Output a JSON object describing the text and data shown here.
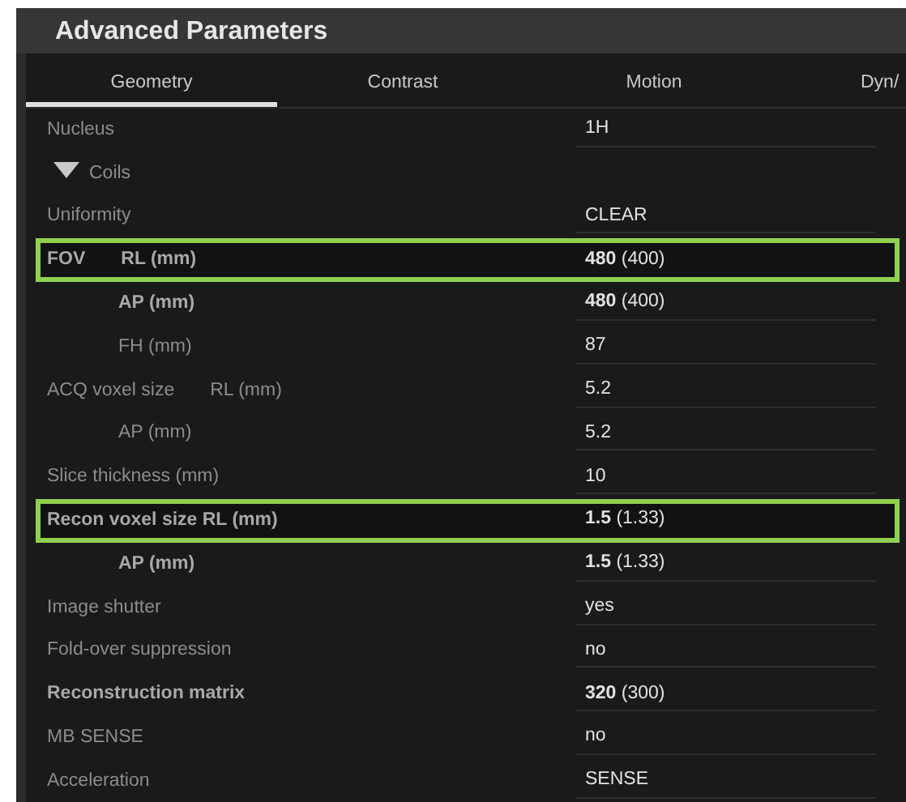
{
  "window": {
    "title": "Advanced Parameters"
  },
  "tabs": [
    {
      "label": "Geometry",
      "selected": true
    },
    {
      "label": "Contrast",
      "selected": false
    },
    {
      "label": "Motion",
      "selected": false
    },
    {
      "label": "Dyn/",
      "selected": false
    }
  ],
  "rows": [
    {
      "kind": "param",
      "label": "Nucleus",
      "value": "1H",
      "modified": false,
      "highlighted": false
    },
    {
      "kind": "group",
      "label": "Coils",
      "expanded": true
    },
    {
      "kind": "param",
      "label": "Uniformity",
      "value": "CLEAR",
      "modified": false,
      "highlighted": false
    },
    {
      "kind": "param",
      "label": "FOV",
      "sublabel": "RL (mm)",
      "value": "**480** (400)",
      "modified": true,
      "highlighted": true
    },
    {
      "kind": "param",
      "sublabel": "AP (mm)",
      "value": "**480** (400)",
      "modified": true,
      "highlighted": false
    },
    {
      "kind": "param",
      "sublabel": "FH (mm)",
      "value": "87",
      "modified": false,
      "highlighted": false
    },
    {
      "kind": "param",
      "label": "ACQ voxel size",
      "sublabel": "RL (mm)",
      "value": "5.2",
      "modified": false,
      "highlighted": false
    },
    {
      "kind": "param",
      "sublabel": "AP (mm)",
      "value": "5.2",
      "modified": false,
      "highlighted": false
    },
    {
      "kind": "param",
      "label": "Slice thickness (mm)",
      "value": "10",
      "modified": false,
      "highlighted": false
    },
    {
      "kind": "param",
      "label": "Recon voxel size RL (mm)",
      "value": "**1.5** (1.33)",
      "modified": true,
      "highlighted": true
    },
    {
      "kind": "param",
      "sublabel": "AP (mm)",
      "value": "**1.5** (1.33)",
      "modified": true,
      "highlighted": false
    },
    {
      "kind": "param",
      "label": "Image shutter",
      "value": "yes",
      "modified": false,
      "highlighted": false
    },
    {
      "kind": "param",
      "label": "Fold-over suppression",
      "value": "no",
      "modified": false,
      "highlighted": false
    },
    {
      "kind": "param",
      "label": "Reconstruction matrix",
      "value": "**320** (300)",
      "modified": true,
      "highlighted": false
    },
    {
      "kind": "param",
      "label": "MB SENSE",
      "value": "no",
      "modified": false,
      "highlighted": false
    },
    {
      "kind": "param",
      "label": "Acceleration",
      "value": "SENSE",
      "modified": false,
      "highlighted": false
    }
  ]
}
